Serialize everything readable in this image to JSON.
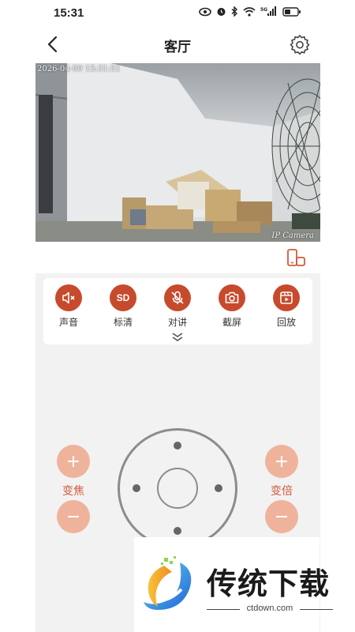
{
  "status_bar": {
    "time": "15:31",
    "icons": [
      "eye-icon",
      "alarm-icon",
      "bluetooth-icon",
      "wifi-icon",
      "5g-signal-icon",
      "battery-icon"
    ],
    "signal_label": "5G"
  },
  "header": {
    "title": "客厅",
    "back_icon": "chevron-left-icon",
    "settings_icon": "gear-icon"
  },
  "video": {
    "timestamp": "2026-04-09 15:31:51",
    "camera_label": "IP Camera"
  },
  "toolbar": {
    "items": [
      {
        "label": "声音",
        "icon": "speaker-mute-icon"
      },
      {
        "label": "标清",
        "icon": "sd-quality-icon",
        "badge": "SD"
      },
      {
        "label": "对讲",
        "icon": "microphone-off-icon"
      },
      {
        "label": "截屏",
        "icon": "camera-icon"
      },
      {
        "label": "回放",
        "icon": "playback-icon"
      }
    ],
    "expand_icon": "chevron-double-down-icon"
  },
  "controls": {
    "focus_label": "变焦",
    "zoom_label": "变倍"
  },
  "watermark": {
    "brand": "传统下载",
    "domain": "ctdown.com"
  },
  "colors": {
    "accent": "#c74a2d",
    "accent_light": "#efb39c",
    "label_red": "#d35a3a",
    "panel_bg": "#f2f2f2"
  }
}
